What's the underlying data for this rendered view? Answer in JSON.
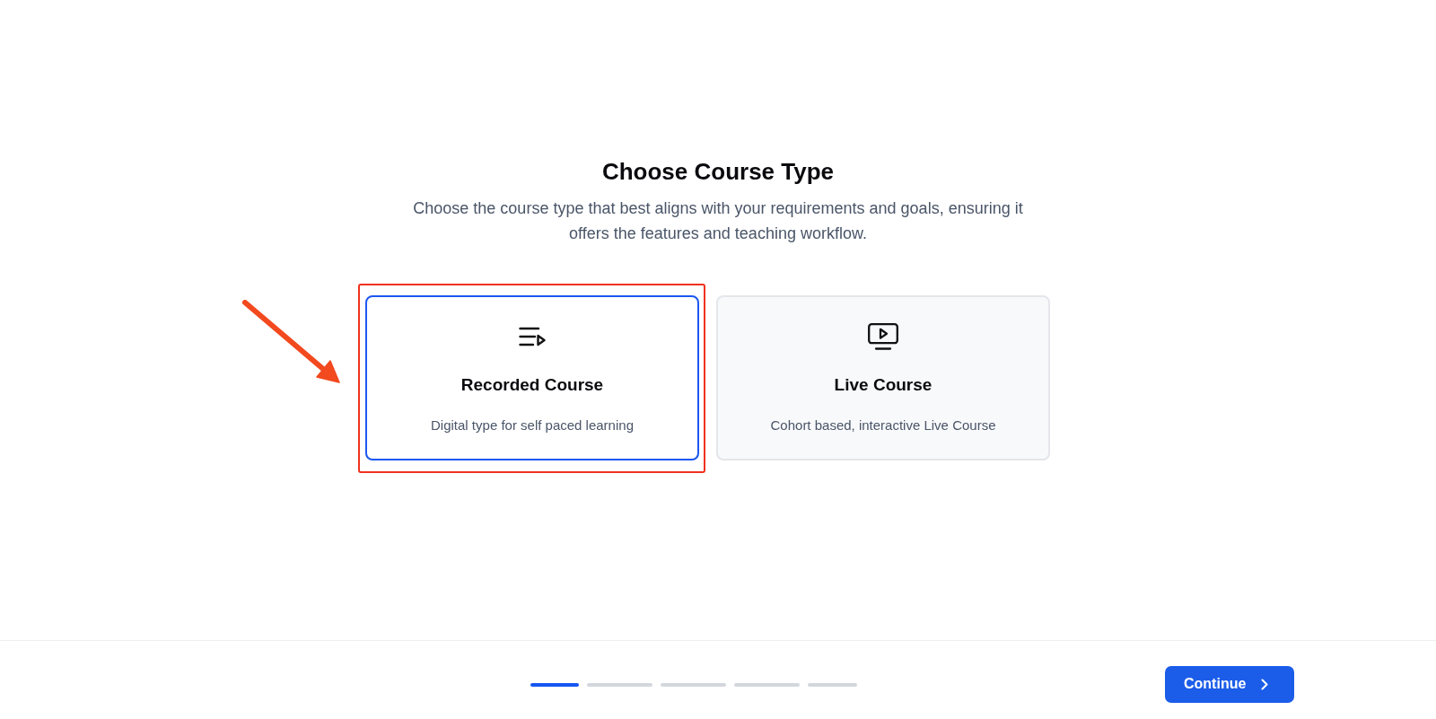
{
  "heading": {
    "title": "Choose Course Type",
    "subtitle": "Choose the course type that best aligns with your requirements and goals, ensuring it offers the features and teaching workflow."
  },
  "course_types": [
    {
      "kind": "recorded",
      "title": "Recorded Course",
      "description": "Digital type for self paced learning",
      "selected": true,
      "annotated": true
    },
    {
      "kind": "live",
      "title": "Live Course",
      "description": "Cohort based, interactive Live Course",
      "selected": false,
      "annotated": false
    }
  ],
  "footer": {
    "steps": [
      {
        "selected": true
      },
      {
        "selected": false
      },
      {
        "selected": false
      },
      {
        "selected": false
      },
      {
        "selected": false
      }
    ],
    "continue_button": "Continue"
  }
}
